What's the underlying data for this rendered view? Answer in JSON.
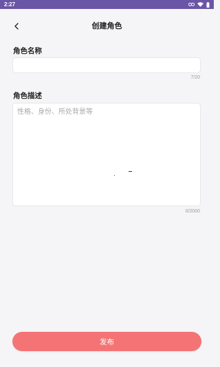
{
  "status_bar": {
    "time": "2:27"
  },
  "header": {
    "title": "创建角色",
    "back_icon": "chevron-left-icon"
  },
  "form": {
    "name_label": "角色名称",
    "name_value": "",
    "name_placeholder": "",
    "name_counter": "7/20",
    "desc_label": "角色描述",
    "desc_value": "",
    "desc_placeholder": "性格、身份、所处背景等",
    "desc_counter": "0/2000"
  },
  "actions": {
    "publish_label": "发布"
  },
  "colors": {
    "status_bar": "#6a55a6",
    "background": "#f5f5f7",
    "publish_button": "#f47476"
  }
}
